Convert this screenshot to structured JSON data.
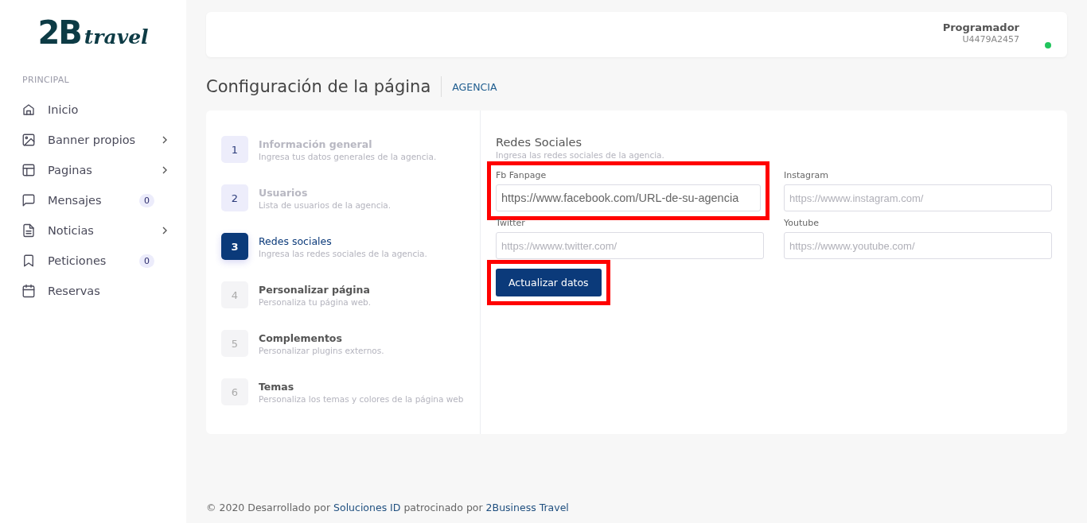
{
  "sidebar": {
    "logo": {
      "mark": "2B",
      "word": "travel"
    },
    "section": "PRINCIPAL",
    "items": [
      {
        "label": "Inicio",
        "chevron": false
      },
      {
        "label": "Banner propios",
        "chevron": true
      },
      {
        "label": "Paginas",
        "chevron": true
      },
      {
        "label": "Mensajes",
        "chevron": false,
        "badge": "0"
      },
      {
        "label": "Noticias",
        "chevron": true
      },
      {
        "label": "Peticiones",
        "chevron": false,
        "badge": "0"
      },
      {
        "label": "Reservas",
        "chevron": false
      }
    ]
  },
  "header": {
    "user_name": "Programador",
    "user_id": "U4479A2457",
    "online": true
  },
  "page": {
    "title": "Configuración de la página",
    "breadcrumb": "AGENCIA"
  },
  "steps": [
    {
      "number": "1",
      "title": "Información general",
      "subtitle": "Ingresa tus datos generales de la agencia.",
      "selected": false,
      "completed": true
    },
    {
      "number": "2",
      "title": "Usuarios",
      "subtitle": "Lista de usuarios de la agencia.",
      "selected": false,
      "completed": true
    },
    {
      "number": "3",
      "title": "Redes sociales",
      "subtitle": "Ingresa las redes sociales de la agencia.",
      "selected": true,
      "completed": false
    },
    {
      "number": "4",
      "title": "Personalizar página",
      "subtitle": "Personaliza tu página web.",
      "selected": false,
      "completed": false
    },
    {
      "number": "5",
      "title": "Complementos",
      "subtitle": "Personalizar plugins externos.",
      "selected": false,
      "completed": false
    },
    {
      "number": "6",
      "title": "Temas",
      "subtitle": "Personaliza los temas y colores de la página web",
      "selected": false,
      "completed": false
    }
  ],
  "form": {
    "title": "Redes Sociales",
    "subtitle": "Ingresa las redes sociales de la agencia.",
    "fields": [
      {
        "label": "Fb Fanpage",
        "value": "https://www.facebook.com/URL-de-su-agencia",
        "highlighted": true
      },
      {
        "label": "Instagram",
        "placeholder": "https://wwww.instagram.com/",
        "highlighted": false
      },
      {
        "label": "Twitter",
        "placeholder": "https://wwww.twitter.com/",
        "highlighted": false
      },
      {
        "label": "Youtube",
        "placeholder": "https://wwww.youtube.com/",
        "highlighted": false
      }
    ],
    "button": {
      "label": "Actualizar datos",
      "highlighted": true
    }
  },
  "footer": "© 2020 Desarrollado por **Soluciones ID** patrocinado por **2Business Travel**"
}
